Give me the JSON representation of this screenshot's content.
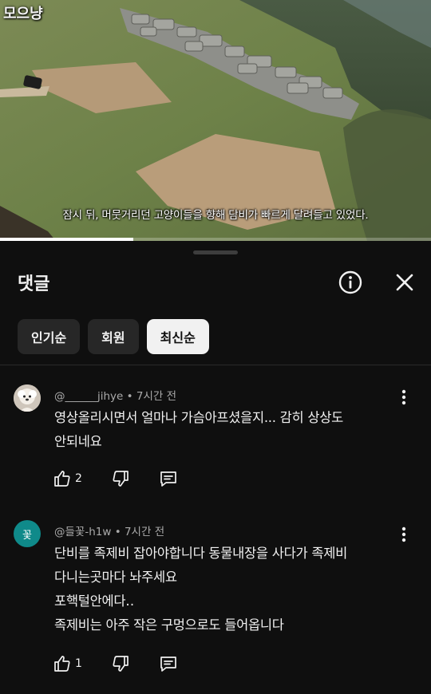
{
  "video": {
    "watermark": "모으냥",
    "subtitle": "잠시 뒤, 머뭇거리던 고양이들을 향해 담비가 빠르게 달려들고 있었다.",
    "progress": 0.31
  },
  "comments_panel": {
    "title": "댓글",
    "info_icon": "info-circle-icon",
    "close_icon": "close-icon",
    "filters": [
      {
        "label": "인기순",
        "active": false
      },
      {
        "label": "회원",
        "active": false
      },
      {
        "label": "최신순",
        "active": true
      }
    ],
    "comments": [
      {
        "author": "@______jihye",
        "time": "7시간 전",
        "lines": [
          "영상올리시면서 얼마나 가슴아프셨을지... 감히 상상도",
          "안되네요"
        ],
        "likes": "2",
        "avatar": "dog-avatar"
      },
      {
        "author": "@들꽃-h1w",
        "time": "7시간 전",
        "avatar_letter": "꽃",
        "lines": [
          "단비를 족제비 잡아야합니다  동물내장을 사다가 족제비",
          "다니는곳마다 놔주세요",
          "포핵털안에다‥",
          "족제비는 아주 작은 구멍으로도 들어옵니다"
        ],
        "likes": "1",
        "avatar_color": "#0f8a8a"
      }
    ]
  }
}
